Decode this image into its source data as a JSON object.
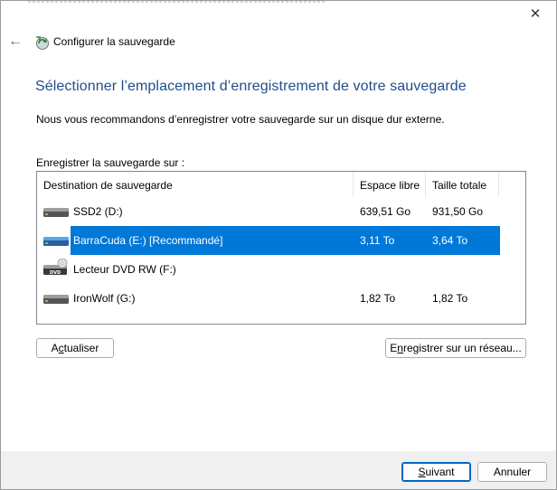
{
  "window": {
    "title": "Configurer la sauvegarde",
    "close_glyph": "✕",
    "back_glyph": "←"
  },
  "heading": "Sélectionner l’emplacement d’enregistrement de votre sauvegarde",
  "description": "Nous vous recommandons d’enregistrer votre sauvegarde sur un disque dur externe.",
  "save_label": "Enregistrer la sauvegarde sur :",
  "list": {
    "columns": [
      "Destination de sauvegarde",
      "Espace libre",
      "Taille totale"
    ],
    "rows": [
      {
        "name": "SSD2 (D:)",
        "free": "639,51 Go",
        "total": "931,50 Go",
        "icon": "hard-drive-icon",
        "selected": false
      },
      {
        "name": "BarraCuda (E:) [Recommandé]",
        "free": "3,11 To",
        "total": "3,64 To",
        "icon": "external-drive-icon",
        "selected": true
      },
      {
        "name": "Lecteur DVD RW (F:)",
        "free": "",
        "total": "",
        "icon": "dvd-drive-icon",
        "selected": false
      },
      {
        "name": "IronWolf (G:)",
        "free": "1,82 To",
        "total": "1,82 To",
        "icon": "hard-drive-icon",
        "selected": false
      }
    ]
  },
  "buttons": {
    "refresh_pre": "A",
    "refresh_u": "c",
    "refresh_post": "tualiser",
    "network_pre": "E",
    "network_u": "n",
    "network_post": "registrer sur un réseau...",
    "next_pre": "",
    "next_u": "S",
    "next_post": "uivant",
    "cancel": "Annuler"
  },
  "colors": {
    "selection": "#0078d7",
    "heading": "#1f4e8c"
  }
}
